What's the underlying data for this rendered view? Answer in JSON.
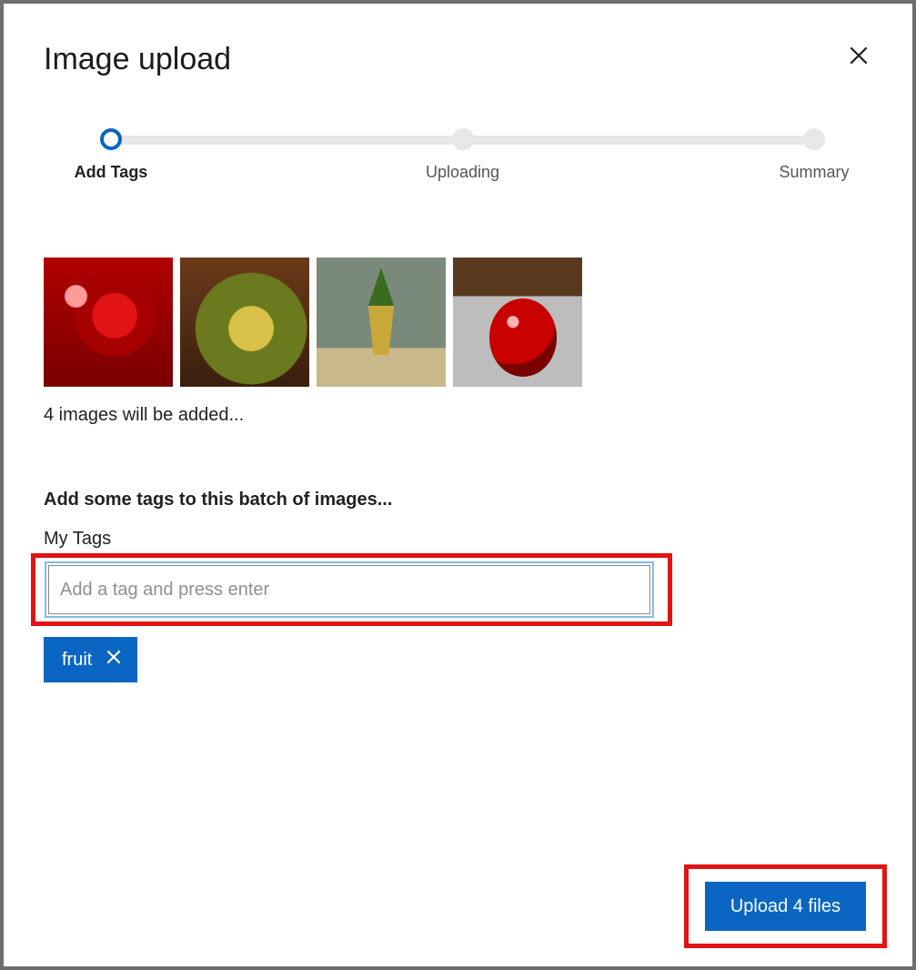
{
  "dialog": {
    "title": "Image upload"
  },
  "stepper": {
    "steps": [
      {
        "label": "Add Tags",
        "active": true
      },
      {
        "label": "Uploading",
        "active": false
      },
      {
        "label": "Summary",
        "active": false
      }
    ]
  },
  "thumbnails": {
    "status": "4 images will be added..."
  },
  "tags_section": {
    "heading": "Add some tags to this batch of images...",
    "label": "My Tags",
    "input_placeholder": "Add a tag and press enter",
    "input_value": "",
    "chips": [
      {
        "text": "fruit"
      }
    ]
  },
  "footer": {
    "upload_button": "Upload 4 files"
  }
}
